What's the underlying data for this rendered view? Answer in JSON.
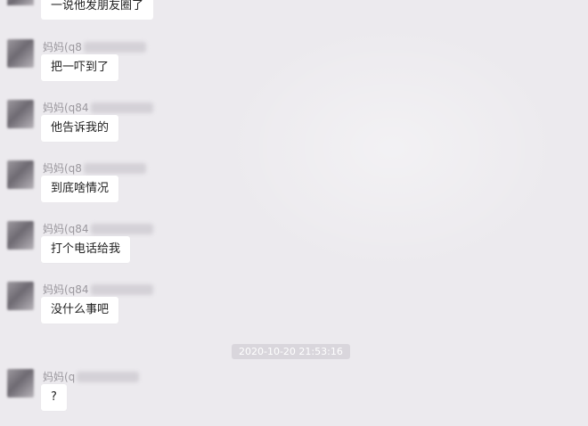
{
  "top_message": {
    "text": "一说他发朋友圈了"
  },
  "messages": [
    {
      "sender": "妈妈(q8",
      "text": "把一吓到了"
    },
    {
      "sender": "妈妈(q84",
      "text": "他告诉我的"
    },
    {
      "sender": "妈妈(q8",
      "text": "到底啥情况"
    },
    {
      "sender": "妈妈(q84",
      "text": "打个电话给我"
    },
    {
      "sender": "妈妈(q84",
      "text": "没什么事吧"
    },
    {
      "sender": "妈妈(q",
      "text": "?"
    }
  ],
  "timestamp": "2020-10-20 21:53:16"
}
